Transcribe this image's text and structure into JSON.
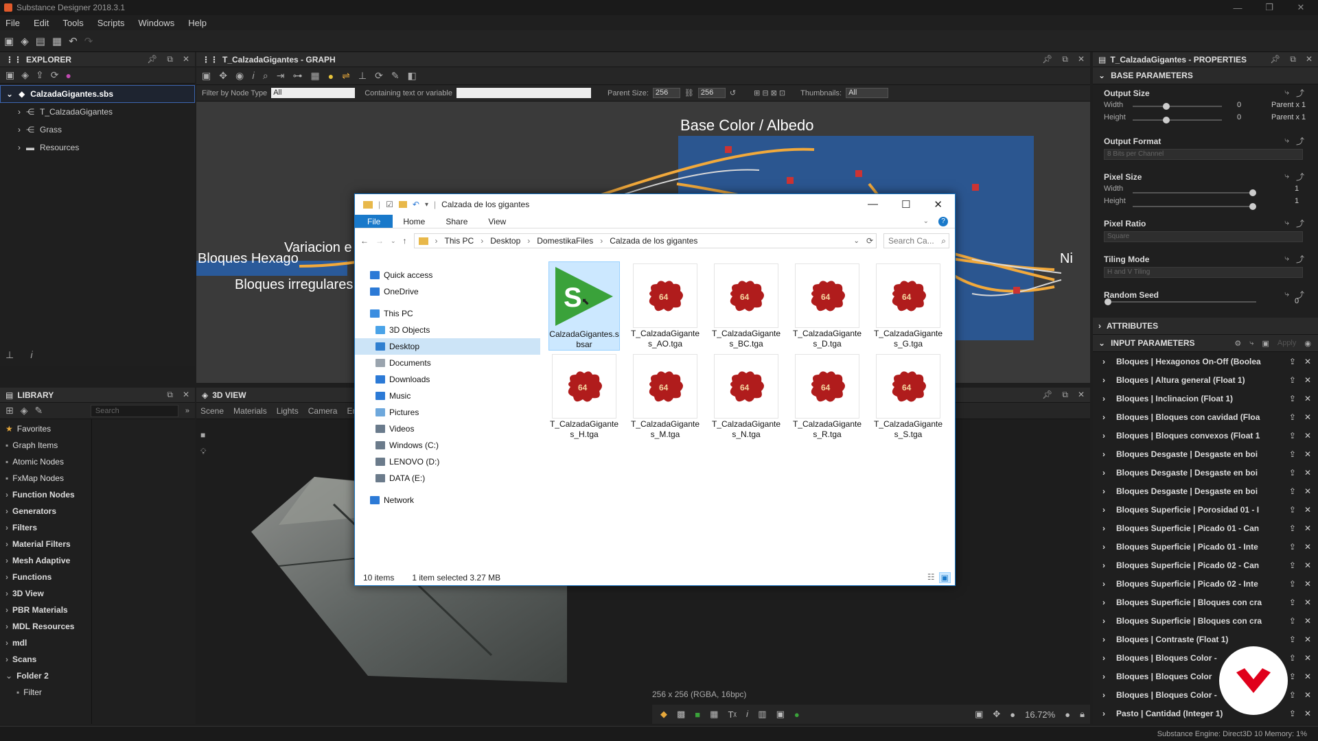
{
  "app": {
    "title": "Substance Designer 2018.3.1"
  },
  "window_controls": {
    "minimize": "—",
    "maximize": "❐",
    "close": "✕"
  },
  "menu": [
    "File",
    "Edit",
    "Tools",
    "Scripts",
    "Windows",
    "Help"
  ],
  "explorer": {
    "title": "EXPLORER",
    "package": "CalzadaGigantes.sbs",
    "items": [
      "T_CalzadaGigantes",
      "Grass",
      "Resources"
    ]
  },
  "graph": {
    "title": "T_CalzadaGigantes - GRAPH",
    "filter_label": "Filter by Node Type",
    "filter_value": "All",
    "containing_label": "Containing text or variable",
    "parent_size_label": "Parent Size:",
    "parent_w": "256",
    "parent_h": "256",
    "thumbnails_label": "Thumbnails:",
    "thumbnails_value": "All",
    "frames": [
      "Base Color / Albedo",
      "Variacion e",
      "Bloques Hexago",
      "Bloques irregulares",
      "Ni"
    ]
  },
  "library": {
    "title": "LIBRARY",
    "search_placeholder": "Search",
    "items": [
      {
        "label": "Favorites",
        "bold": false
      },
      {
        "label": "Graph Items",
        "bold": false
      },
      {
        "label": "Atomic Nodes",
        "bold": false
      },
      {
        "label": "FxMap Nodes",
        "bold": false
      },
      {
        "label": "Function Nodes",
        "bold": true
      },
      {
        "label": "Generators",
        "bold": true
      },
      {
        "label": "Filters",
        "bold": true
      },
      {
        "label": "Material Filters",
        "bold": true
      },
      {
        "label": "Mesh Adaptive",
        "bold": true
      },
      {
        "label": "Functions",
        "bold": true
      },
      {
        "label": "3D View",
        "bold": true
      },
      {
        "label": "PBR Materials",
        "bold": true
      },
      {
        "label": "MDL Resources",
        "bold": true
      },
      {
        "label": "mdl",
        "bold": true
      },
      {
        "label": "Scans",
        "bold": true
      },
      {
        "label": "Folder 2",
        "bold": true
      },
      {
        "label": "Filter",
        "bold": false
      }
    ]
  },
  "view3d": {
    "title": "3D VIEW",
    "menu": [
      "Scene",
      "Materials",
      "Lights",
      "Camera",
      "Enviro"
    ],
    "resolution": "256 x 256 (RGBA, 16bpc)",
    "zoom": "16.72%"
  },
  "properties": {
    "title": "T_CalzadaGigantes - PROPERTIES",
    "base_params": "BASE PARAMETERS",
    "output_size": "Output Size",
    "width_label": "Width",
    "height_label": "Height",
    "out_w_val": "0",
    "out_h_val": "0",
    "out_w_suffix": "Parent x 1",
    "out_h_suffix": "Parent x 1",
    "output_format": "Output Format",
    "output_format_value": "8 Bits per Channel",
    "pixel_size": "Pixel Size",
    "px_w_val": "1",
    "px_h_val": "1",
    "pixel_ratio": "Pixel Ratio",
    "pixel_ratio_value": "Square",
    "tiling_mode": "Tiling Mode",
    "tiling_mode_value": "H and V Tiling",
    "random_seed": "Random Seed",
    "random_seed_value": "0",
    "attributes": "ATTRIBUTES",
    "input_params": "INPUT PARAMETERS",
    "apply": "Apply",
    "inputs": [
      "Bloques | Hexagonos On-Off (Boolea",
      "Bloques | Altura general (Float 1)",
      "Bloques | Inclinacion (Float 1)",
      "Bloques | Bloques con cavidad (Floa",
      "Bloques | Bloques convexos (Float 1",
      "Bloques Desgaste | Desgaste en boi",
      "Bloques Desgaste | Desgaste en boi",
      "Bloques Desgaste | Desgaste en boi",
      "Bloques Superficie | Porosidad 01 - I",
      "Bloques Superficie | Picado 01 - Can",
      "Bloques Superficie | Picado 01 - Inte",
      "Bloques Superficie | Picado 02 - Can",
      "Bloques Superficie | Picado 02 - Inte",
      "Bloques Superficie | Bloques con cra",
      "Bloques Superficie | Bloques con cra",
      "Bloques | Contraste (Float 1)",
      "Bloques | Bloques Color -",
      "Bloques | Bloques Color",
      "Bloques | Bloques Color -",
      "Pasto | Cantidad (Integer 1)"
    ]
  },
  "statusbar": {
    "engine": "Substance Engine: Direct3D 10  Memory: 1%"
  },
  "file_explorer": {
    "title": "Calzada de los gigantes",
    "ribbon": [
      "File",
      "Home",
      "Share",
      "View"
    ],
    "breadcrumb": [
      "This PC",
      "Desktop",
      "DomestikaFiles",
      "Calzada de los gigantes"
    ],
    "search_placeholder": "Search Ca...",
    "nav": [
      {
        "label": "Quick access",
        "indent": 0,
        "icon": "star-icon",
        "color": "#2c7ad6"
      },
      {
        "label": "OneDrive",
        "indent": 0,
        "icon": "cloud-icon",
        "color": "#2c7ad6"
      },
      {
        "label": "This PC",
        "indent": 0,
        "icon": "computer-icon",
        "color": "#3a8de0"
      },
      {
        "label": "3D Objects",
        "indent": 1,
        "icon": "cube-icon",
        "color": "#4aa3e8"
      },
      {
        "label": "Desktop",
        "indent": 1,
        "icon": "desktop-icon",
        "color": "#2f7fd0",
        "selected": true
      },
      {
        "label": "Documents",
        "indent": 1,
        "icon": "document-icon",
        "color": "#9aa4ae"
      },
      {
        "label": "Downloads",
        "indent": 1,
        "icon": "download-icon",
        "color": "#2c7ad6"
      },
      {
        "label": "Music",
        "indent": 1,
        "icon": "music-icon",
        "color": "#2c7ad6"
      },
      {
        "label": "Pictures",
        "indent": 1,
        "icon": "picture-icon",
        "color": "#6ea8dc"
      },
      {
        "label": "Videos",
        "indent": 1,
        "icon": "video-icon",
        "color": "#6a7b8c"
      },
      {
        "label": "Windows (C:)",
        "indent": 1,
        "icon": "drive-icon",
        "color": "#6b7b8b"
      },
      {
        "label": "LENOVO (D:)",
        "indent": 1,
        "icon": "drive-icon",
        "color": "#6b7b8b"
      },
      {
        "label": "DATA (E:)",
        "indent": 1,
        "icon": "drive-icon",
        "color": "#6b7b8b"
      },
      {
        "label": "Network",
        "indent": 0,
        "icon": "network-icon",
        "color": "#2c7ad6"
      }
    ],
    "files": [
      {
        "name": "CalzadaGigantes.sbsar",
        "kind": "sbsar",
        "selected": true
      },
      {
        "name": "T_CalzadaGigantes_AO.tga",
        "kind": "tga"
      },
      {
        "name": "T_CalzadaGigantes_BC.tga",
        "kind": "tga"
      },
      {
        "name": "T_CalzadaGigantes_D.tga",
        "kind": "tga"
      },
      {
        "name": "T_CalzadaGigantes_G.tga",
        "kind": "tga"
      },
      {
        "name": "T_CalzadaGigantes_H.tga",
        "kind": "tga"
      },
      {
        "name": "T_CalzadaGigantes_M.tga",
        "kind": "tga"
      },
      {
        "name": "T_CalzadaGigantes_N.tga",
        "kind": "tga"
      },
      {
        "name": "T_CalzadaGigantes_R.tga",
        "kind": "tga"
      },
      {
        "name": "T_CalzadaGigantes_S.tga",
        "kind": "tga"
      }
    ],
    "thumb_badge": "64",
    "status_count": "10 items",
    "status_selected": "1 item selected  3.27 MB"
  },
  "colors": {
    "accent": "#1979ca",
    "graph_frame": "#2a5a9a",
    "link": "#f2a93b",
    "sbsar_green": "#3aa23a",
    "tga_red": "#b01c1c"
  }
}
